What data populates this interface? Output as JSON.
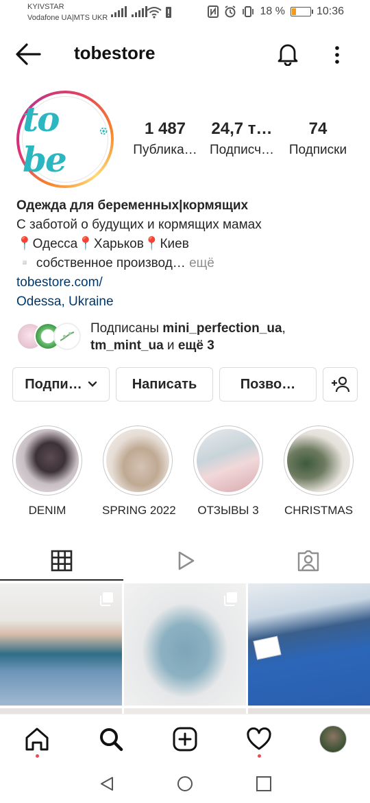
{
  "status_bar": {
    "carrier_line1": "KYIVSTAR",
    "carrier_line2": "Vodafone UA|MTS UKR",
    "battery_percent": "18 %",
    "time": "10:36"
  },
  "header": {
    "username": "tobestore",
    "back_icon": "arrow-left-icon",
    "notification_icon": "bell-icon",
    "menu_icon": "more-vertical-icon"
  },
  "profile": {
    "logo_text": "to be",
    "stats": [
      {
        "value": "1 487",
        "label": "Публика…"
      },
      {
        "value": "24,7 т…",
        "label": "Подписч…"
      },
      {
        "value": "74",
        "label": "Подписки"
      }
    ],
    "bio": {
      "name": "Одежда для беременных|кормящих",
      "line1": "С заботой о будущих и кормящих мамах",
      "line2": "📍Одесса📍Харьков📍Киев",
      "line3": "▫️ собственное производ…",
      "more": " ещё",
      "website": "tobestore.com/",
      "location": "Odessa, Ukraine"
    },
    "followed_by": {
      "prefix": "Подписаны ",
      "user1": "mini_perfection_ua",
      "comma": ",",
      "user2": "tm_mint_ua",
      "and": " и ",
      "others": "ещё 3"
    }
  },
  "buttons": {
    "follow": "Подпи…",
    "message": "Написать",
    "call": "Позво…",
    "add_user_icon": "add-person-icon"
  },
  "highlights": [
    {
      "label": "DENIM"
    },
    {
      "label": "SPRING 2022"
    },
    {
      "label": "ОТЗЫВЫ 3"
    },
    {
      "label": "CHRISTMAS"
    }
  ],
  "tabs": [
    {
      "icon": "grid-icon",
      "active": true
    },
    {
      "icon": "reels-play-icon",
      "active": false
    },
    {
      "icon": "tagged-person-icon",
      "active": false
    }
  ],
  "bottom_nav": [
    {
      "icon": "home-icon"
    },
    {
      "icon": "search-icon"
    },
    {
      "icon": "add-post-icon"
    },
    {
      "icon": "heart-icon"
    },
    {
      "icon": "profile-avatar-icon"
    }
  ],
  "colors": {
    "link": "#00376b",
    "accent_dot": "#ed4956",
    "logo": "#2bb6c0"
  }
}
